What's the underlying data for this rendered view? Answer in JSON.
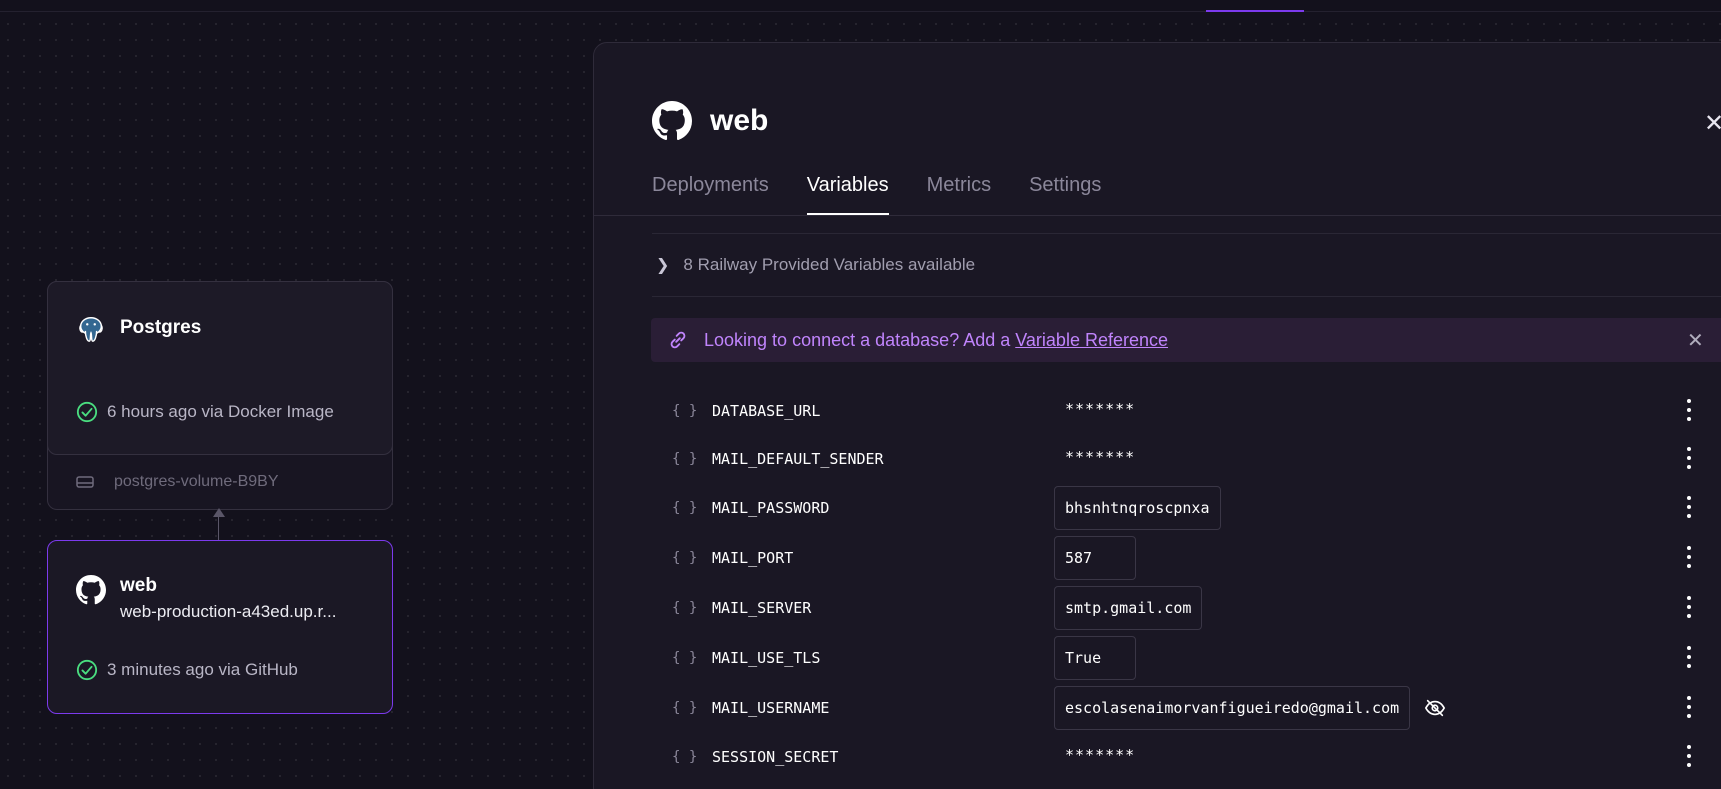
{
  "canvas": {
    "postgres_card": {
      "title": "Postgres",
      "status": "6 hours ago via Docker Image",
      "volume": "postgres-volume-B9BY"
    },
    "web_card": {
      "title": "web",
      "url": "web-production-a43ed.up.r...",
      "status": "3 minutes ago via GitHub"
    }
  },
  "panel": {
    "title": "web",
    "close_symbol": "✕",
    "tabs": [
      {
        "label": "Deployments",
        "active": false
      },
      {
        "label": "Variables",
        "active": true
      },
      {
        "label": "Metrics",
        "active": false
      },
      {
        "label": "Settings",
        "active": false
      }
    ],
    "provided_variables": "8 Railway Provided Variables available",
    "banner": {
      "text": "Looking to connect a database? Add a",
      "link": "Variable Reference",
      "close_symbol": "✕"
    },
    "brace_symbol": "{ }",
    "variables": [
      {
        "name": "DATABASE_URL",
        "value": "*******",
        "masked": true
      },
      {
        "name": "MAIL_DEFAULT_SENDER",
        "value": "*******",
        "masked": true
      },
      {
        "name": "MAIL_PASSWORD",
        "value": "bhsnhtnqroscpnxa",
        "masked": false
      },
      {
        "name": "MAIL_PORT",
        "value": "587",
        "masked": false
      },
      {
        "name": "MAIL_SERVER",
        "value": "smtp.gmail.com",
        "masked": false
      },
      {
        "name": "MAIL_USE_TLS",
        "value": "True",
        "masked": false
      },
      {
        "name": "MAIL_USERNAME",
        "value": "escolasenaimorvanfigueiredo@gmail.com",
        "masked": false
      },
      {
        "name": "SESSION_SECRET",
        "value": "*******",
        "masked": true
      }
    ]
  },
  "colors": {
    "accent": "#7c3aed",
    "banner_text": "#c084fc",
    "success": "#4ade80"
  },
  "icons": [
    "github-icon",
    "postgres-icon",
    "check-circle-icon",
    "hard-drive-icon",
    "close-icon",
    "chevron-right-icon",
    "link-icon",
    "eye-off-icon",
    "more-vertical-icon"
  ]
}
